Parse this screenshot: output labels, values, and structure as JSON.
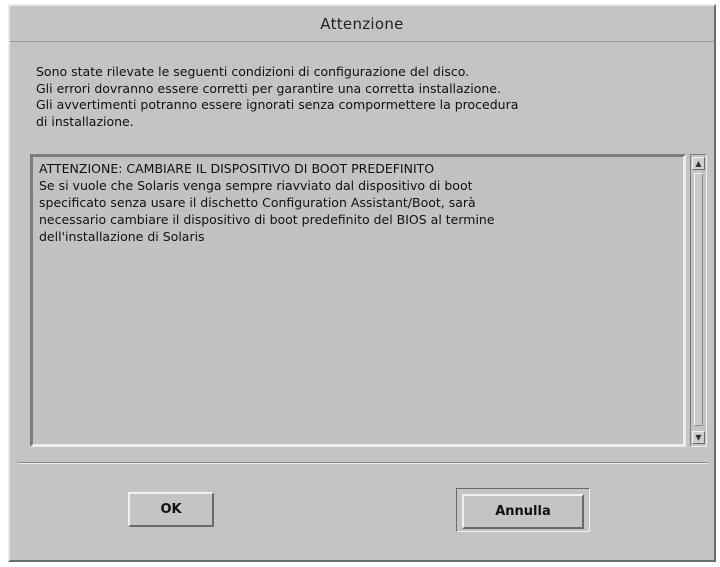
{
  "dialog": {
    "title": "Attenzione"
  },
  "intro_lines": [
    "Sono state rilevate le seguenti condizioni di configurazione del disco.",
    "Gli errori dovranno essere corretti per garantire una corretta installazione.",
    "Gli avvertimenti potranno essere ignorati senza compormettere la procedura",
    "di installazione."
  ],
  "message": {
    "lines": [
      "ATTENZIONE: CAMBIARE IL DISPOSITIVO DI BOOT PREDEFINITO",
      "Se si vuole che Solaris venga sempre riavviato dal dispositivo di boot",
      "specificato senza usare il dischetto Configuration Assistant/Boot, sarà",
      "necessario cambiare il dispositivo di boot predefinito del BIOS al termine",
      "dell'installazione di Solaris"
    ]
  },
  "scrollbar": {
    "up_icon": "arrow-up-icon",
    "down_icon": "arrow-down-icon"
  },
  "buttons": {
    "ok_label": "OK",
    "cancel_label": "Annulla"
  },
  "colors": {
    "background": "#c4c4c4"
  }
}
